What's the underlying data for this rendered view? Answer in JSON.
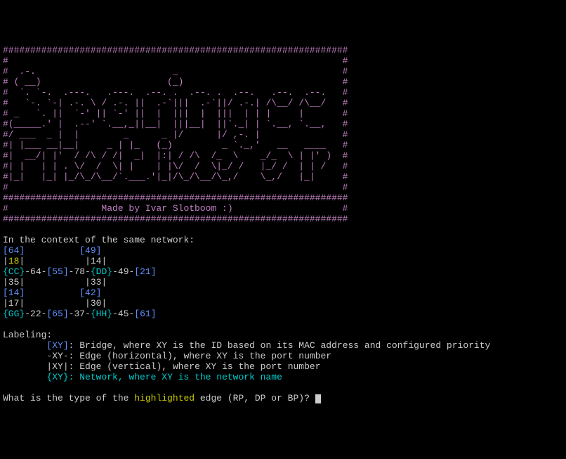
{
  "banner": {
    "lines": [
      "###############################################################",
      "#                                                             #",
      "#  .-.                         _                              #",
      "# ( __)                       (_)                             #",
      "#  `. `-.  .---.   .---.  .--. .  .--. .  .--.   .--.  .--.   #",
      "#   `-. `-| .-. \\ / .-. ||  .-`|||  .-`||/ .-.| /\\__/ /\\__/   #",
      "# _   `. ||  `-' || `-' ||  |  |||  |  |||  | | |     |       #",
      "#(_____.' |  .--' `.__,_||__|  |||__|  ||`._| | `.__, `.__,   #",
      "#/ ___  _ |  |        _      _ |/      |/ ,-. |               #",
      "#| |___ __|__|     _ | |_   (_)         _ `._,'   __   ____   #",
      "#|  __/| |'  / /\\ / /|  _|  |:| / /\\  /_  \\    _/_  \\ | |' )  #",
      "#| |   | | . \\/  /  \\| |    | |\\/  /  \\|_/ /   |_/ /  | | /   #",
      "#|_|   |_| |_/\\_/\\__/`.___.'|_|/\\_/\\__/\\_,/    \\_,/   |_|     #",
      "#                                                             #",
      "###############################################################",
      "#                 Made by Ivar Slotboom :)                    #",
      "###############################################################"
    ]
  },
  "context_line": "In the context of the same network:",
  "topology": {
    "row1": {
      "pre": "",
      "b1": "[64]",
      "mid": "          ",
      "b2": "[49]"
    },
    "row2": {
      "p1_open": "|",
      "p1_val": "18",
      "p1_close": "|",
      "mid": "           ",
      "p2": "|14|"
    },
    "row3": {
      "n1": "{CC}",
      "e1": "-64-",
      "b1": "[55]",
      "e2": "-78-",
      "n2": "{DD}",
      "e3": "-49-",
      "b2": "[21]"
    },
    "row4": {
      "p1": "|35|",
      "mid": "           ",
      "p2": "|33|"
    },
    "row5": {
      "b1": "[14]",
      "mid": "          ",
      "b2": "[42]"
    },
    "row6": {
      "p1": "|17|",
      "mid": "           ",
      "p2": "|30|"
    },
    "row7": {
      "n1": "{GG}",
      "e1": "-22-",
      "b1": "[65]",
      "e2": "-37-",
      "n2": "{HH}",
      "e3": "-45-",
      "b2": "[61]"
    }
  },
  "labeling_header": "Labeling:",
  "labeling": {
    "bridge": {
      "tag": "[XY]",
      "text": ": Bridge, where XY is the ID based on its MAC address and configured priority"
    },
    "edge_h": {
      "tag": "-XY-",
      "text": ": Edge (horizontal), where XY is the port number"
    },
    "edge_v": {
      "tag": "|XY|",
      "text": ": Edge (vertical), where XY is the port number"
    },
    "network": {
      "tag": "{XY}",
      "text": ": Network, where XY is the network name"
    }
  },
  "question": {
    "pre": "What is the type of the ",
    "highlighted": "highlighted",
    "post": " edge (RP, DP or BP)? "
  }
}
